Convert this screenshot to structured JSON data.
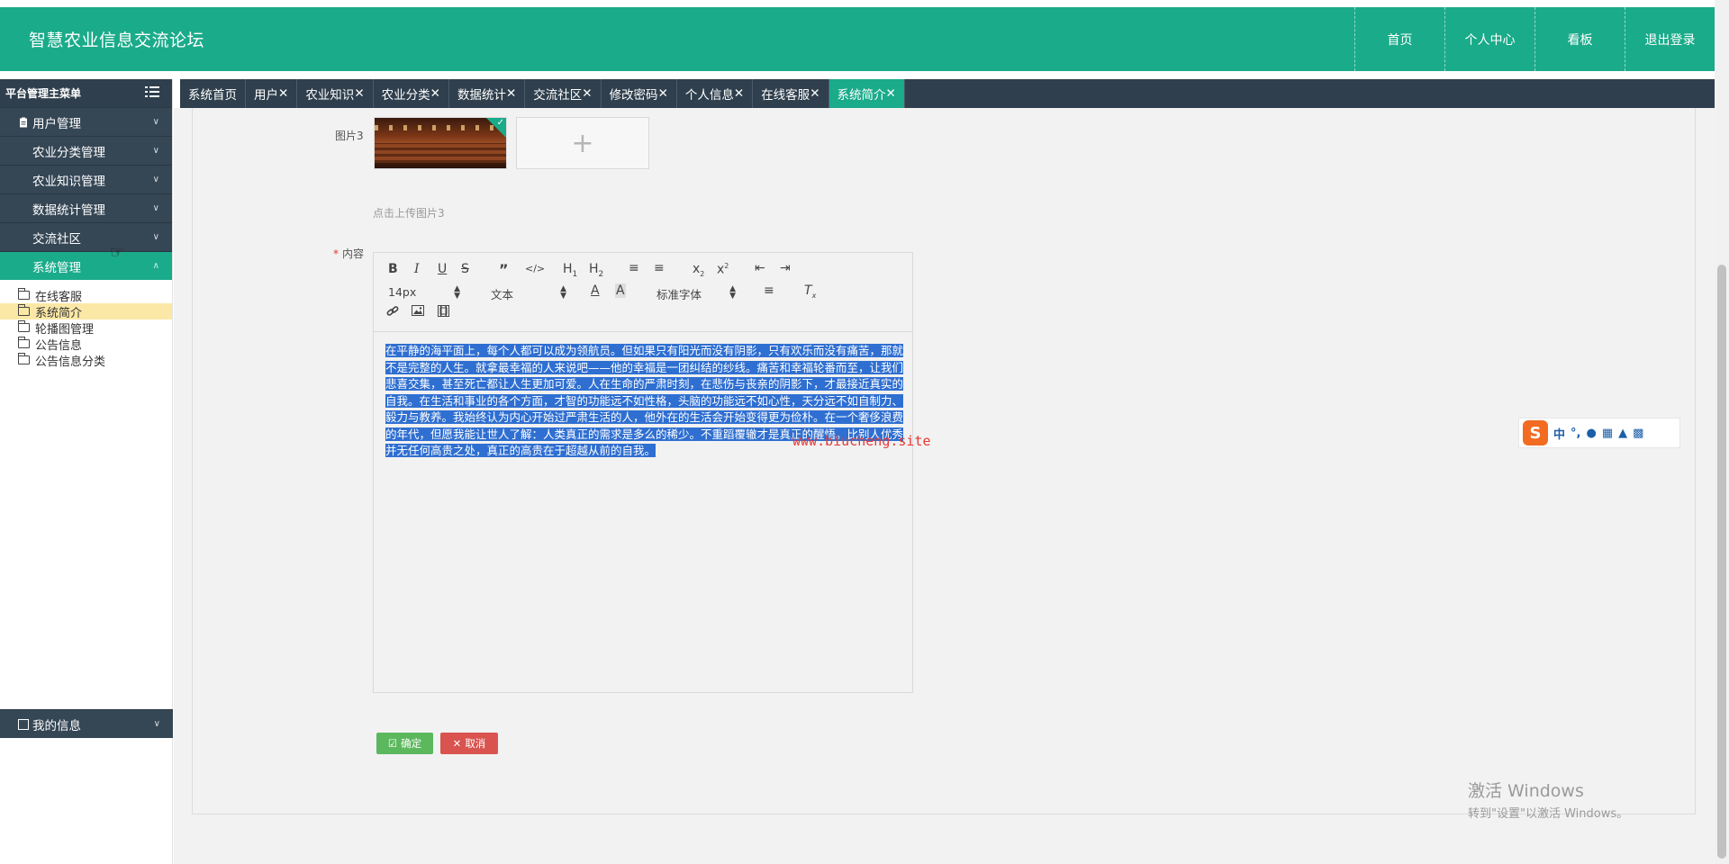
{
  "header": {
    "title": "智慧农业信息交流论坛",
    "nav": [
      "首页",
      "个人中心",
      "看板",
      "退出登录"
    ]
  },
  "sidebar": {
    "title": "平台管理主菜单",
    "menu": [
      {
        "label": "用户管理",
        "icon": "clipboard-icon"
      },
      {
        "label": "农业分类管理",
        "icon": "grid-icon"
      },
      {
        "label": "农业知识管理",
        "icon": "grid-icon"
      },
      {
        "label": "数据统计管理",
        "icon": "grid-icon"
      },
      {
        "label": "交流社区",
        "icon": "grid-icon"
      },
      {
        "label": "系统管理",
        "icon": "grid-icon",
        "expanded": true
      }
    ],
    "submenu": [
      "在线客服",
      "系统简介",
      "轮播图管理",
      "公告信息",
      "公告信息分类"
    ],
    "active_sub": "系统简介",
    "bottom": {
      "label": "我的信息"
    }
  },
  "tabs": [
    {
      "label": "系统首页",
      "closable": false
    },
    {
      "label": "用户",
      "closable": true
    },
    {
      "label": "农业知识",
      "closable": true
    },
    {
      "label": "农业分类",
      "closable": true
    },
    {
      "label": "数据统计",
      "closable": true
    },
    {
      "label": "交流社区",
      "closable": true
    },
    {
      "label": "修改密码",
      "closable": true
    },
    {
      "label": "个人信息",
      "closable": true
    },
    {
      "label": "在线客服",
      "closable": true
    },
    {
      "label": "系统简介",
      "closable": true,
      "active": true
    }
  ],
  "form": {
    "image_label": "图片3",
    "upload_plus": "+",
    "upload_hint": "点击上传图片3",
    "content_required_mark": "*",
    "content_label": "内容"
  },
  "editor": {
    "font_size": "14px",
    "block_type": "文本",
    "font_family": "标准字体",
    "text": "在平静的海平面上，每个人都可以成为领航员。但如果只有阳光而没有阴影，只有欢乐而没有痛苦，那就不是完整的人生。就拿最幸福的人来说吧——他的幸福是一团纠结的纱线。痛苦和幸福轮番而至，让我们悲喜交集，甚至死亡都让人生更加可爱。人在生命的严肃时刻，在悲伤与丧亲的阴影下，才最接近真实的自我。在生活和事业的各个方面，才智的功能远不如性格，头脑的功能远不如心性，天分远不如自制力、毅力与教养。我始终认为内心开始过严肃生活的人，他外在的生活会开始变得更为俭朴。在一个奢侈浪费的年代，但愿我能让世人了解：人类真正的需求是多么的稀少。不重蹈覆辙才是真正的醒悟。比别人优秀并无任何高贵之处，真正的高贵在于超越从前的自我。"
  },
  "buttons": {
    "ok": "确定",
    "cancel": "取消"
  },
  "watermark": "www.biucheng.site",
  "ime": {
    "lang": "中"
  },
  "windows_activation": {
    "line1": "激活 Windows",
    "line2": "转到\"设置\"以激活 Windows。"
  },
  "colors": {
    "primary": "#1aab8a",
    "dark": "#2f3f4d",
    "ok": "#5cb85c",
    "cancel": "#d9534f",
    "selection": "#2f6fd1"
  }
}
